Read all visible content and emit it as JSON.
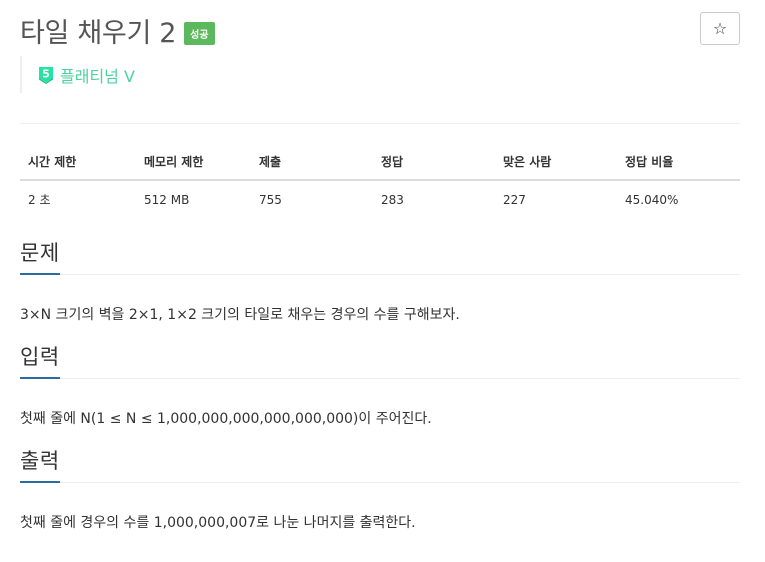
{
  "problem": {
    "title": "타일 채우기 2",
    "status_label": "성공",
    "star_icon": "☆",
    "tier": {
      "icon": "platinum-5-icon",
      "icon_digit": "5",
      "label": "플래티넘 V",
      "color": "#27e2a4"
    }
  },
  "info_table": {
    "headers": [
      "시간 제한",
      "메모리 제한",
      "제출",
      "정답",
      "맞은 사람",
      "정답 비율"
    ],
    "row": [
      "2 초",
      "512 MB",
      "755",
      "283",
      "227",
      "45.040%"
    ]
  },
  "sections": {
    "description": {
      "title": "문제",
      "body": "3×N 크기의 벽을 2×1, 1×2 크기의 타일로 채우는 경우의 수를 구해보자."
    },
    "input": {
      "title": "입력",
      "body": "첫째 줄에 N(1 ≤ N ≤ 1,000,000,000,000,000,000)이 주어진다."
    },
    "output": {
      "title": "출력",
      "body": "첫째 줄에 경우의 수를 1,000,000,007로 나눈 나머지를 출력한다."
    }
  },
  "colors": {
    "success_badge": "#5cb85c",
    "section_underline": "#2d6a9f",
    "tier_platinum": "#27e2a4"
  }
}
